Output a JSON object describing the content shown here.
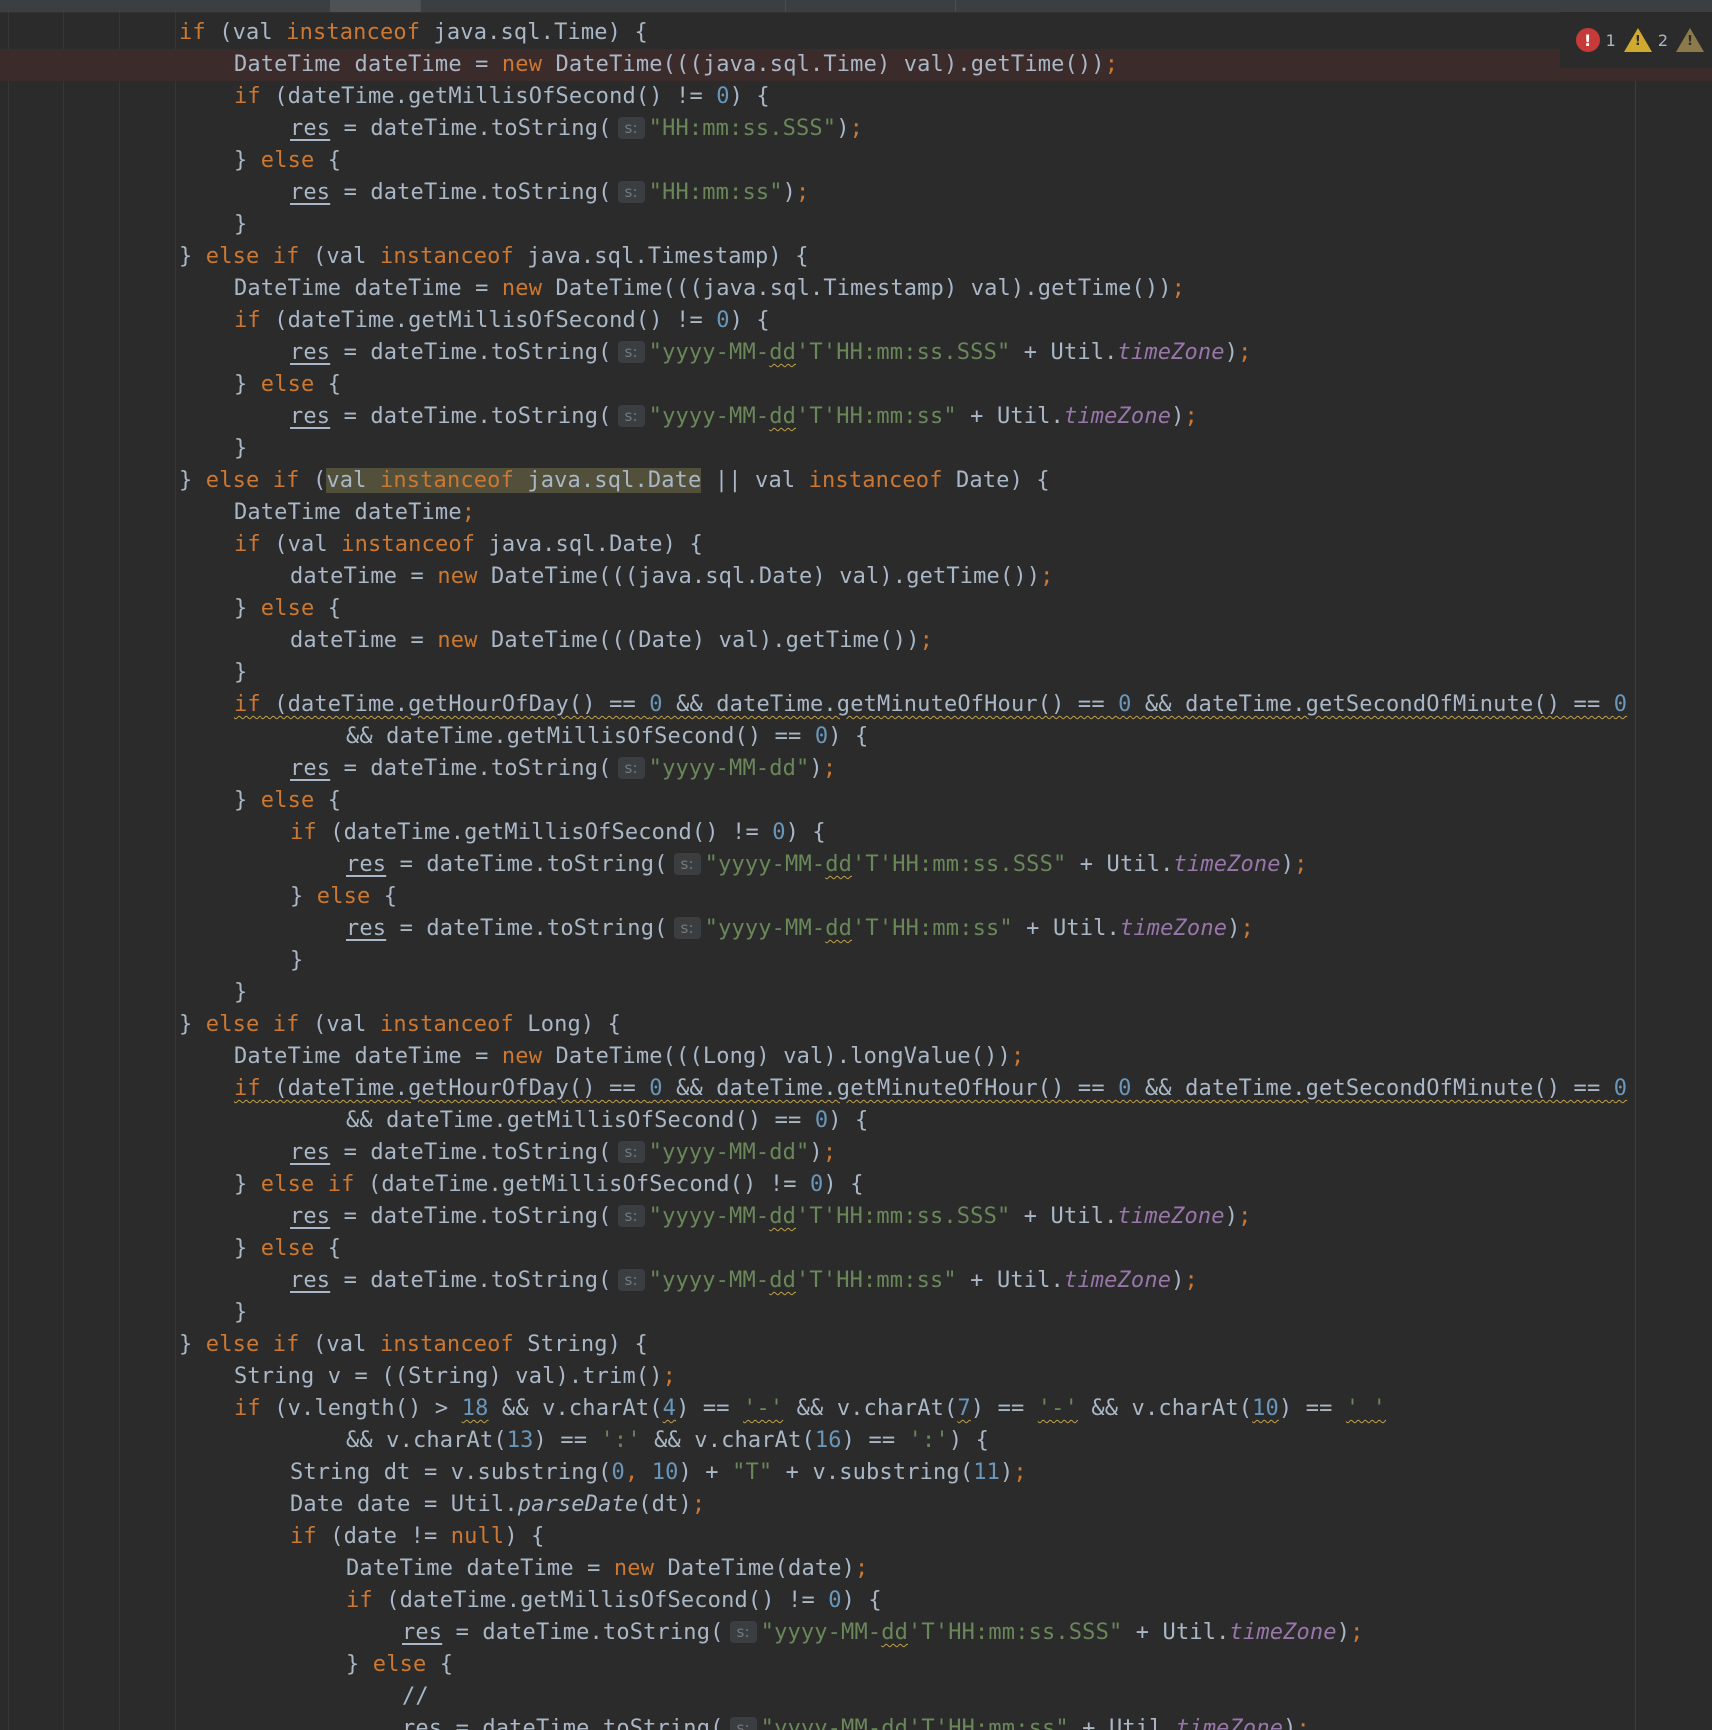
{
  "inspections": {
    "errors": "1",
    "warnings": "2",
    "error_icon": "error-icon",
    "warning_icon": "warning-icon",
    "weak_warning_icon": "weak-warning-icon"
  },
  "colors": {
    "background": "#2b2b2b",
    "keyword": "#cc7832",
    "number": "#6897bb",
    "string": "#6a8759",
    "field": "#9876aa",
    "text": "#a9b7c6"
  },
  "hint": "s:",
  "code": {
    "l1": {
      "p1": "if",
      "p2": " (val ",
      "p3": "instanceof",
      "p4": " java.sql.Time) {"
    },
    "l2": {
      "p1": "DateTime dateTime = ",
      "p2": "new",
      "p3": " DateTime(((java.sql.Time) val).getTime())",
      "p4": ";"
    },
    "l3": {
      "p1": "if",
      "p2": " (dateTime.getMillisOfSecond() != ",
      "p3": "0",
      "p4": ") {"
    },
    "l4": {
      "p1": "res",
      "p2": " = dateTime.toString(",
      "p3": "\"HH:mm:ss.SSS\"",
      "p4": ")",
      "p5": ";"
    },
    "l5": {
      "p1": "} ",
      "p2": "else",
      "p3": " {"
    },
    "l6": {
      "p1": "res",
      "p2": " = dateTime.toString(",
      "p3": "\"HH:mm:ss\"",
      "p4": ")",
      "p5": ";"
    },
    "l7": {
      "p1": "}"
    },
    "l8": {
      "p1": "} ",
      "p2": "else if",
      "p3": " (val ",
      "p4": "instanceof",
      "p5": " java.sql.Timestamp) {"
    },
    "l9": {
      "p1": "DateTime dateTime = ",
      "p2": "new",
      "p3": " DateTime(((java.sql.Timestamp) val).getTime())",
      "p4": ";"
    },
    "l10": {
      "p1": "if",
      "p2": " (dateTime.getMillisOfSecond() != ",
      "p3": "0",
      "p4": ") {"
    },
    "l11": {
      "p1": "res",
      "p2": " = dateTime.toString(",
      "p3": "\"yyyy-MM-",
      "p4": "dd",
      "p5": "'T'HH:mm:ss.SSS\"",
      "p6": " + Util.",
      "p7": "timeZone",
      "p8": ")",
      "p9": ";"
    },
    "l12": {
      "p1": "} ",
      "p2": "else",
      "p3": " {"
    },
    "l13": {
      "p1": "res",
      "p2": " = dateTime.toString(",
      "p3": "\"yyyy-MM-",
      "p4": "dd",
      "p5": "'T'HH:mm:ss\"",
      "p6": " + Util.",
      "p7": "timeZone",
      "p8": ")",
      "p9": ";"
    },
    "l14": {
      "p1": "}"
    },
    "l15": {
      "p1": "} ",
      "p2": "else if",
      "p3": " (",
      "p4": "val ",
      "p5": "instanceof",
      "p6": " java.sql.Date",
      "p7": " || val ",
      "p8": "instanceof",
      "p9": " Date) {"
    },
    "l16": {
      "p1": "DateTime dateTime",
      "p2": ";"
    },
    "l17": {
      "p1": "if",
      "p2": " (val ",
      "p3": "instanceof",
      "p4": " java.sql.Date) {"
    },
    "l18": {
      "p1": "dateTime = ",
      "p2": "new",
      "p3": " DateTime(((java.sql.Date) val).getTime())",
      "p4": ";"
    },
    "l19": {
      "p1": "} ",
      "p2": "else",
      "p3": " {"
    },
    "l20": {
      "p1": "dateTime = ",
      "p2": "new",
      "p3": " DateTime(((Date) val).getTime())",
      "p4": ";"
    },
    "l21": {
      "p1": "}"
    },
    "l22": {
      "p1": "if",
      "p2": " (dateTime.getHourOfDay() == ",
      "p3": "0",
      "p4": " && dateTime.getMinuteOfHour() == ",
      "p5": "0",
      "p6": " && dateTime.getSecondOfMinute() == ",
      "p7": "0"
    },
    "l23": {
      "p1": "&& dateTime.getMillisOfSecond() == ",
      "p2": "0",
      "p3": ") {"
    },
    "l24": {
      "p1": "res",
      "p2": " = dateTime.toString(",
      "p3": "\"yyyy-MM-dd\"",
      "p4": ")",
      "p5": ";"
    },
    "l25": {
      "p1": "} ",
      "p2": "else",
      "p3": " {"
    },
    "l26": {
      "p1": "if",
      "p2": " (dateTime.getMillisOfSecond() != ",
      "p3": "0",
      "p4": ") {"
    },
    "l27": {
      "p1": "res",
      "p2": " = dateTime.toString(",
      "p3": "\"yyyy-MM-",
      "p4": "dd",
      "p5": "'T'HH:mm:ss.SSS\"",
      "p6": " + Util.",
      "p7": "timeZone",
      "p8": ")",
      "p9": ";"
    },
    "l28": {
      "p1": "} ",
      "p2": "else",
      "p3": " {"
    },
    "l29": {
      "p1": "res",
      "p2": " = dateTime.toString(",
      "p3": "\"yyyy-MM-",
      "p4": "dd",
      "p5": "'T'HH:mm:ss\"",
      "p6": " + Util.",
      "p7": "timeZone",
      "p8": ")",
      "p9": ";"
    },
    "l30": {
      "p1": "}"
    },
    "l31": {
      "p1": "}"
    },
    "l32": {
      "p1": "} ",
      "p2": "else if",
      "p3": " (val ",
      "p4": "instanceof",
      "p5": " Long) {"
    },
    "l33": {
      "p1": "DateTime dateTime = ",
      "p2": "new",
      "p3": " DateTime(((Long) val).longValue())",
      "p4": ";"
    },
    "l34": {
      "p1": "if",
      "p2": " (dateTime.getHourOfDay() == ",
      "p3": "0",
      "p4": " && dateTime.getMinuteOfHour() == ",
      "p5": "0",
      "p6": " && dateTime.getSecondOfMinute() == ",
      "p7": "0"
    },
    "l35": {
      "p1": "&& dateTime.getMillisOfSecond() == ",
      "p2": "0",
      "p3": ") {"
    },
    "l36": {
      "p1": "res",
      "p2": " = dateTime.toString(",
      "p3": "\"yyyy-MM-dd\"",
      "p4": ")",
      "p5": ";"
    },
    "l37": {
      "p1": "} ",
      "p2": "else if",
      "p3": " (dateTime.getMillisOfSecond() != ",
      "p4": "0",
      "p5": ") {"
    },
    "l38": {
      "p1": "res",
      "p2": " = dateTime.toString(",
      "p3": "\"yyyy-MM-",
      "p4": "dd",
      "p5": "'T'HH:mm:ss.SSS\"",
      "p6": " + Util.",
      "p7": "timeZone",
      "p8": ")",
      "p9": ";"
    },
    "l39": {
      "p1": "} ",
      "p2": "else",
      "p3": " {"
    },
    "l40": {
      "p1": "res",
      "p2": " = dateTime.toString(",
      "p3": "\"yyyy-MM-",
      "p4": "dd",
      "p5": "'T'HH:mm:ss\"",
      "p6": " + Util.",
      "p7": "timeZone",
      "p8": ")",
      "p9": ";"
    },
    "l41": {
      "p1": "}"
    },
    "l42": {
      "p1": "} ",
      "p2": "else if",
      "p3": " (val ",
      "p4": "instanceof",
      "p5": " String) {"
    },
    "l43": {
      "p1": "String v = ((String) val).trim()",
      "p2": ";"
    },
    "l44": {
      "p1": "if",
      "p2": " (v.length() > ",
      "p3": "18",
      "p4": " && v.charAt(",
      "p5": "4",
      "p6": ") == ",
      "p7": "'-'",
      "p8": " && v.charAt(",
      "p9": "7",
      "p10": ") == ",
      "p11": "'-'",
      "p12": " && v.charAt(",
      "p13": "10",
      "p14": ") == ",
      "p15": "' '"
    },
    "l45": {
      "p1": "&& v.charAt(",
      "p2": "13",
      "p3": ") == ",
      "p4": "':'",
      "p5": " && v.charAt(",
      "p6": "16",
      "p7": ") == ",
      "p8": "':'",
      "p9": ") {"
    },
    "l46": {
      "p1": "String dt = v.substring(",
      "p2": "0",
      "p3": ", ",
      "p4": "10",
      "p5": ") + ",
      "p6": "\"T\"",
      "p7": " + v.substring(",
      "p8": "11",
      "p9": ")",
      "p10": ";"
    },
    "l47": {
      "p1": "Date date = Util.",
      "p2": "parseDate",
      "p3": "(dt)",
      "p4": ";"
    },
    "l48": {
      "p1": "if",
      "p2": " (date != ",
      "p3": "null",
      "p4": ") {"
    },
    "l49": {
      "p1": "DateTime dateTime = ",
      "p2": "new",
      "p3": " DateTime(date)",
      "p4": ";"
    },
    "l50": {
      "p1": "if",
      "p2": " (dateTime.getMillisOfSecond() != ",
      "p3": "0",
      "p4": ") {"
    },
    "l51": {
      "p1": "res",
      "p2": " = dateTime.toString(",
      "p3": "\"yyyy-MM-",
      "p4": "dd",
      "p5": "'T'HH:mm:ss.SSS\"",
      "p6": " + Util.",
      "p7": "timeZone",
      "p8": ")",
      "p9": ";"
    },
    "l52": {
      "p1": "} ",
      "p2": "else",
      "p3": " {"
    },
    "l53": {
      "p1": "//"
    },
    "l54": {
      "p1": "res",
      "p2": " = dateTime.toString(",
      "p3": "\"yyyy-MM-",
      "p4": "dd",
      "p5": "'T'HH:mm:ss\"",
      "p6": " + Util.",
      "p7": "timeZone",
      "p8": ")",
      "p9": ";"
    }
  }
}
